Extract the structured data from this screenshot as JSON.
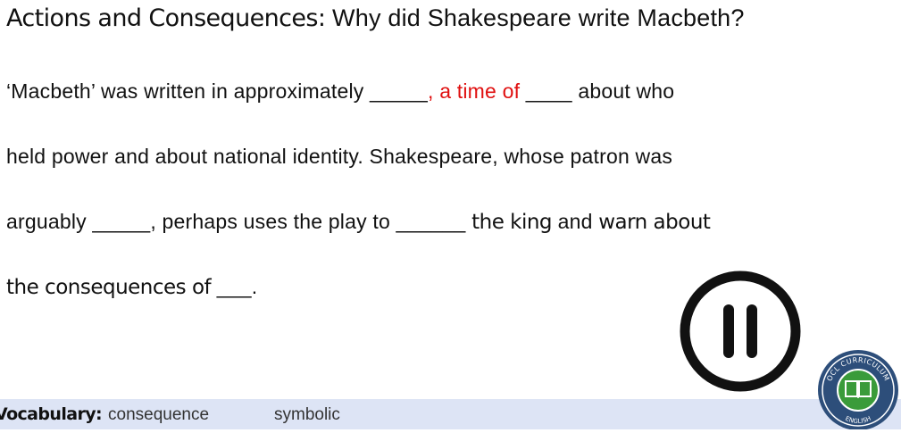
{
  "slide": {
    "title_main": "Actions and Consequences:",
    "title_sub": " Why did Shakespeare write Macbeth?"
  },
  "paragraph": {
    "l1_a": "‘Macbeth’ was written in approximately _____",
    "l1_red": ", a time of",
    "l1_b": " ____ about who",
    "l2": "held power and about national identity. Shakespeare, whose patron was",
    "l3_a": "arguably _____, perhaps uses the play to ______ ",
    "l3_bold1": "the king",
    "l3_mid": " and ",
    "l3_bold2": "warn about",
    "l4_bold": "the consequences of",
    "l4_end": " ___."
  },
  "vocabulary": {
    "label": "Vocabulary:",
    "words": [
      "consequence",
      "symbolic"
    ]
  },
  "logo": {
    "top_text": "OCL CURRICULUM",
    "bottom_text": "ENGLISH"
  },
  "icons": {
    "pause": "pause-icon",
    "logo_book": "book-icon"
  },
  "colors": {
    "highlight": "#e01010",
    "vocab_bar": "#dde4f5",
    "logo_navy": "#2d4e7a",
    "logo_green": "#3a9b3a"
  }
}
